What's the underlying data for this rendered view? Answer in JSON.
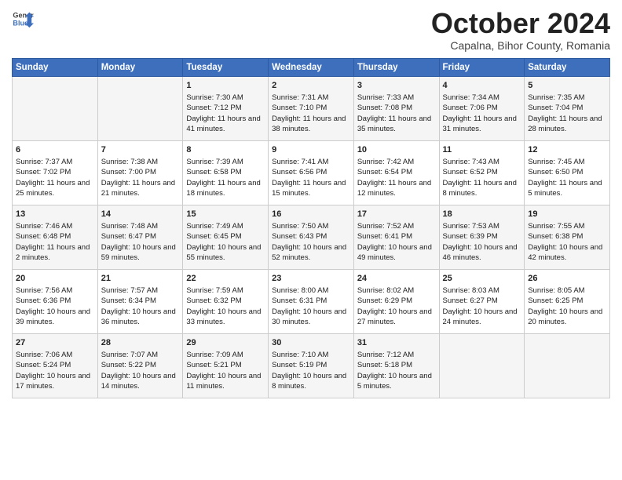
{
  "header": {
    "logo_line1": "General",
    "logo_line2": "Blue",
    "month": "October 2024",
    "location": "Capalna, Bihor County, Romania"
  },
  "weekdays": [
    "Sunday",
    "Monday",
    "Tuesday",
    "Wednesday",
    "Thursday",
    "Friday",
    "Saturday"
  ],
  "weeks": [
    [
      {
        "day": "",
        "sunrise": "",
        "sunset": "",
        "daylight": ""
      },
      {
        "day": "",
        "sunrise": "",
        "sunset": "",
        "daylight": ""
      },
      {
        "day": "1",
        "sunrise": "Sunrise: 7:30 AM",
        "sunset": "Sunset: 7:12 PM",
        "daylight": "Daylight: 11 hours and 41 minutes."
      },
      {
        "day": "2",
        "sunrise": "Sunrise: 7:31 AM",
        "sunset": "Sunset: 7:10 PM",
        "daylight": "Daylight: 11 hours and 38 minutes."
      },
      {
        "day": "3",
        "sunrise": "Sunrise: 7:33 AM",
        "sunset": "Sunset: 7:08 PM",
        "daylight": "Daylight: 11 hours and 35 minutes."
      },
      {
        "day": "4",
        "sunrise": "Sunrise: 7:34 AM",
        "sunset": "Sunset: 7:06 PM",
        "daylight": "Daylight: 11 hours and 31 minutes."
      },
      {
        "day": "5",
        "sunrise": "Sunrise: 7:35 AM",
        "sunset": "Sunset: 7:04 PM",
        "daylight": "Daylight: 11 hours and 28 minutes."
      }
    ],
    [
      {
        "day": "6",
        "sunrise": "Sunrise: 7:37 AM",
        "sunset": "Sunset: 7:02 PM",
        "daylight": "Daylight: 11 hours and 25 minutes."
      },
      {
        "day": "7",
        "sunrise": "Sunrise: 7:38 AM",
        "sunset": "Sunset: 7:00 PM",
        "daylight": "Daylight: 11 hours and 21 minutes."
      },
      {
        "day": "8",
        "sunrise": "Sunrise: 7:39 AM",
        "sunset": "Sunset: 6:58 PM",
        "daylight": "Daylight: 11 hours and 18 minutes."
      },
      {
        "day": "9",
        "sunrise": "Sunrise: 7:41 AM",
        "sunset": "Sunset: 6:56 PM",
        "daylight": "Daylight: 11 hours and 15 minutes."
      },
      {
        "day": "10",
        "sunrise": "Sunrise: 7:42 AM",
        "sunset": "Sunset: 6:54 PM",
        "daylight": "Daylight: 11 hours and 12 minutes."
      },
      {
        "day": "11",
        "sunrise": "Sunrise: 7:43 AM",
        "sunset": "Sunset: 6:52 PM",
        "daylight": "Daylight: 11 hours and 8 minutes."
      },
      {
        "day": "12",
        "sunrise": "Sunrise: 7:45 AM",
        "sunset": "Sunset: 6:50 PM",
        "daylight": "Daylight: 11 hours and 5 minutes."
      }
    ],
    [
      {
        "day": "13",
        "sunrise": "Sunrise: 7:46 AM",
        "sunset": "Sunset: 6:48 PM",
        "daylight": "Daylight: 11 hours and 2 minutes."
      },
      {
        "day": "14",
        "sunrise": "Sunrise: 7:48 AM",
        "sunset": "Sunset: 6:47 PM",
        "daylight": "Daylight: 10 hours and 59 minutes."
      },
      {
        "day": "15",
        "sunrise": "Sunrise: 7:49 AM",
        "sunset": "Sunset: 6:45 PM",
        "daylight": "Daylight: 10 hours and 55 minutes."
      },
      {
        "day": "16",
        "sunrise": "Sunrise: 7:50 AM",
        "sunset": "Sunset: 6:43 PM",
        "daylight": "Daylight: 10 hours and 52 minutes."
      },
      {
        "day": "17",
        "sunrise": "Sunrise: 7:52 AM",
        "sunset": "Sunset: 6:41 PM",
        "daylight": "Daylight: 10 hours and 49 minutes."
      },
      {
        "day": "18",
        "sunrise": "Sunrise: 7:53 AM",
        "sunset": "Sunset: 6:39 PM",
        "daylight": "Daylight: 10 hours and 46 minutes."
      },
      {
        "day": "19",
        "sunrise": "Sunrise: 7:55 AM",
        "sunset": "Sunset: 6:38 PM",
        "daylight": "Daylight: 10 hours and 42 minutes."
      }
    ],
    [
      {
        "day": "20",
        "sunrise": "Sunrise: 7:56 AM",
        "sunset": "Sunset: 6:36 PM",
        "daylight": "Daylight: 10 hours and 39 minutes."
      },
      {
        "day": "21",
        "sunrise": "Sunrise: 7:57 AM",
        "sunset": "Sunset: 6:34 PM",
        "daylight": "Daylight: 10 hours and 36 minutes."
      },
      {
        "day": "22",
        "sunrise": "Sunrise: 7:59 AM",
        "sunset": "Sunset: 6:32 PM",
        "daylight": "Daylight: 10 hours and 33 minutes."
      },
      {
        "day": "23",
        "sunrise": "Sunrise: 8:00 AM",
        "sunset": "Sunset: 6:31 PM",
        "daylight": "Daylight: 10 hours and 30 minutes."
      },
      {
        "day": "24",
        "sunrise": "Sunrise: 8:02 AM",
        "sunset": "Sunset: 6:29 PM",
        "daylight": "Daylight: 10 hours and 27 minutes."
      },
      {
        "day": "25",
        "sunrise": "Sunrise: 8:03 AM",
        "sunset": "Sunset: 6:27 PM",
        "daylight": "Daylight: 10 hours and 24 minutes."
      },
      {
        "day": "26",
        "sunrise": "Sunrise: 8:05 AM",
        "sunset": "Sunset: 6:25 PM",
        "daylight": "Daylight: 10 hours and 20 minutes."
      }
    ],
    [
      {
        "day": "27",
        "sunrise": "Sunrise: 7:06 AM",
        "sunset": "Sunset: 5:24 PM",
        "daylight": "Daylight: 10 hours and 17 minutes."
      },
      {
        "day": "28",
        "sunrise": "Sunrise: 7:07 AM",
        "sunset": "Sunset: 5:22 PM",
        "daylight": "Daylight: 10 hours and 14 minutes."
      },
      {
        "day": "29",
        "sunrise": "Sunrise: 7:09 AM",
        "sunset": "Sunset: 5:21 PM",
        "daylight": "Daylight: 10 hours and 11 minutes."
      },
      {
        "day": "30",
        "sunrise": "Sunrise: 7:10 AM",
        "sunset": "Sunset: 5:19 PM",
        "daylight": "Daylight: 10 hours and 8 minutes."
      },
      {
        "day": "31",
        "sunrise": "Sunrise: 7:12 AM",
        "sunset": "Sunset: 5:18 PM",
        "daylight": "Daylight: 10 hours and 5 minutes."
      },
      {
        "day": "",
        "sunrise": "",
        "sunset": "",
        "daylight": ""
      },
      {
        "day": "",
        "sunrise": "",
        "sunset": "",
        "daylight": ""
      }
    ]
  ]
}
